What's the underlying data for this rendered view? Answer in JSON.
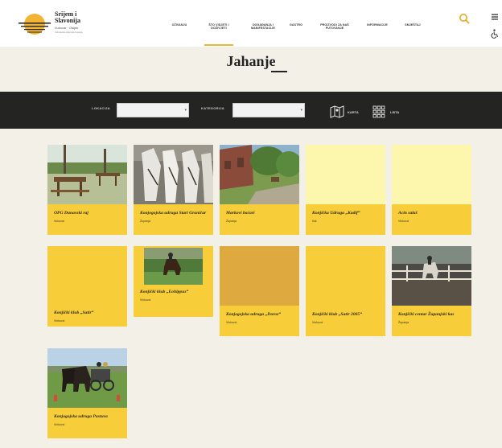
{
  "brand": {
    "title": "Srijem i Slavonija",
    "subtitle": "Vukovar · Osijek",
    "tagline": "Vukovarsko-srijemska županija"
  },
  "nav": {
    "items": [
      {
        "label": "OŽIVANJU"
      },
      {
        "label": "ŠTO VIDJETI I DOŽIVJETI"
      },
      {
        "label": "DOGAĐANJA I MANIFESTACIJE"
      },
      {
        "label": "GASTRO"
      },
      {
        "label": "PROIZVODI ZA NAŠ PUTOVANJE"
      },
      {
        "label": "INFORMACIJE"
      },
      {
        "label": "SMJEŠTAJ"
      }
    ],
    "active_index": 1
  },
  "page": {
    "title": "Jahanje"
  },
  "filters": {
    "location_label": "LOKACIJA",
    "category_label": "KATEGORIJA",
    "location_value": "",
    "category_value": "",
    "map_label": "KARTA",
    "list_label": "LISTA"
  },
  "cards": [
    {
      "title": "OPG Dunavski raj",
      "location": "Vukovar"
    },
    {
      "title": "Konjogojska udruga Stari Graničar",
      "location": "Županja"
    },
    {
      "title": "Markovi baćari",
      "location": "Županja"
    },
    {
      "title": "Konjička Udruga „Kadif“",
      "location": "Ilok"
    },
    {
      "title": "Acin salaš",
      "location": "Vinkovci"
    },
    {
      "title": "Konjički klub „Satir“",
      "location": "Vinkovci"
    },
    {
      "title": "Konjički klub „Eohippus“",
      "location": "Vinkovci"
    },
    {
      "title": "Konjogojska udruga „Doroz“",
      "location": "Vinkovci"
    },
    {
      "title": "Konjički klub „Satir 2005“",
      "location": "Vinkovci"
    },
    {
      "title": "Konjički centar Županjski kas",
      "location": "Županja"
    },
    {
      "title": "Konjogojska udruga Pastuva",
      "location": "Vinkovci"
    }
  ],
  "colors": {
    "accent": "#f7cd3a",
    "filter_bar": "#242422",
    "background": "#f3f1e7"
  }
}
